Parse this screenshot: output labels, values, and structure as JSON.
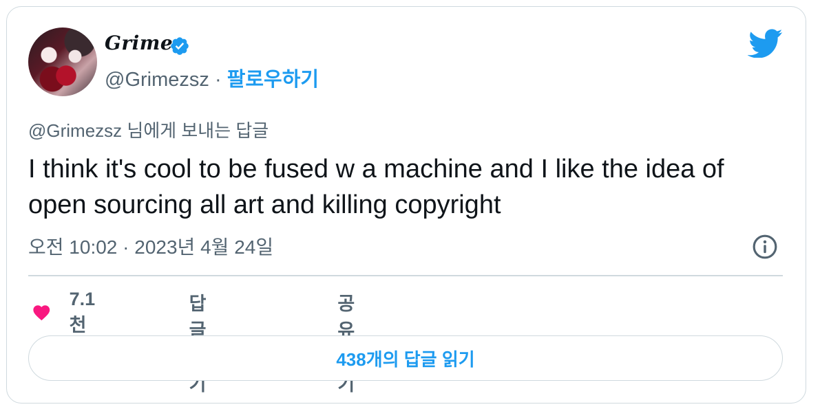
{
  "author": {
    "display_name": "Grimes",
    "handle": "@Grimezsz",
    "separator": "·",
    "follow_label": "팔로우하기"
  },
  "tweet": {
    "reply_to": "@Grimezsz 님에게 보내는 답글",
    "text": "I think it's cool to be fused w a machine and I like the idea of open sourcing all art and killing copyright",
    "timestamp": "오전 10:02 · 2023년 4월 24일"
  },
  "actions": {
    "like_count": "7.1천",
    "reply_label": "답글하기",
    "share_label": "공유하기"
  },
  "read_replies_label": "438개의 답글 읽기",
  "icons": {
    "verified": "verified-badge-icon",
    "brand": "twitter-bird-icon",
    "info": "info-icon",
    "like": "heart-icon",
    "reply": "speech-bubble-icon",
    "share": "share-upload-icon"
  },
  "colors": {
    "accent": "#1d9bf0",
    "like": "#f91880",
    "text": "#0f1419",
    "muted": "#536471",
    "border": "#cfd9de"
  }
}
